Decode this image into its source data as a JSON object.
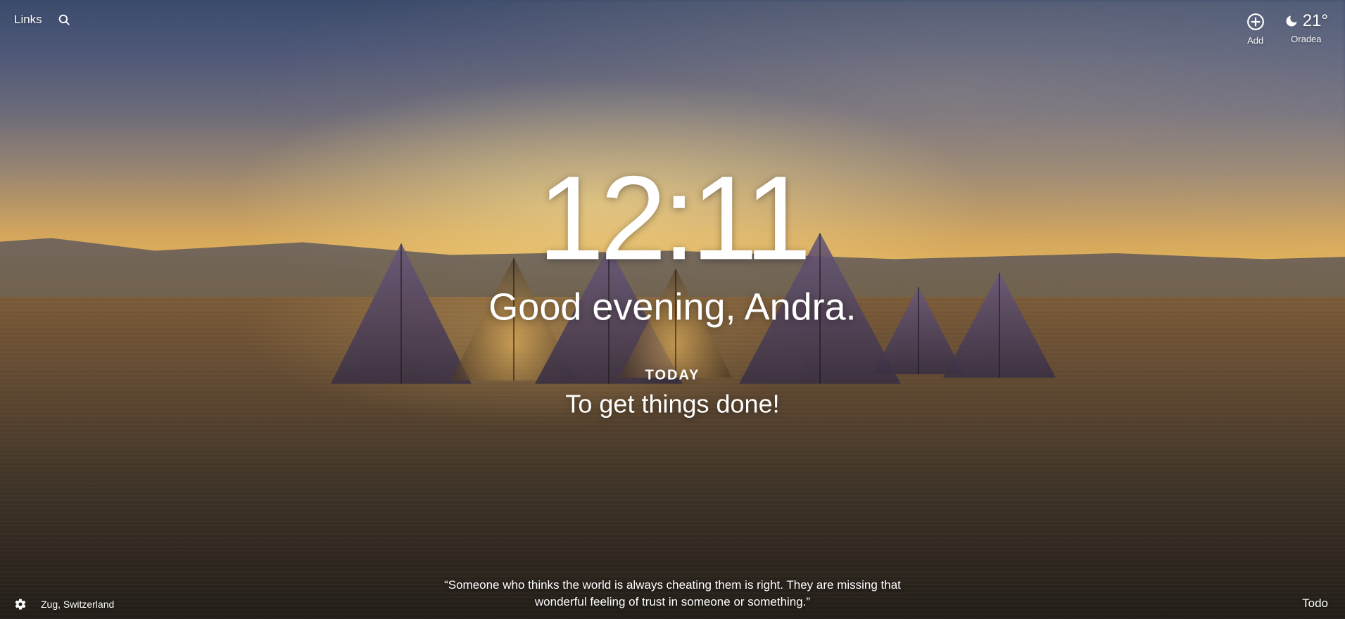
{
  "top": {
    "links_label": "Links",
    "add_label": "Add",
    "weather": {
      "temperature": "21°",
      "city": "Oradea"
    }
  },
  "center": {
    "time": "12:11",
    "greeting": "Good evening, Andra.",
    "today_label": "TODAY",
    "today_focus": "To get things done!"
  },
  "bottom": {
    "location": "Zug, Switzerland",
    "quote": "“Someone who thinks the world is always cheating them is right. They are missing that wonderful feeling of trust in someone or something.”",
    "todo_label": "Todo"
  }
}
